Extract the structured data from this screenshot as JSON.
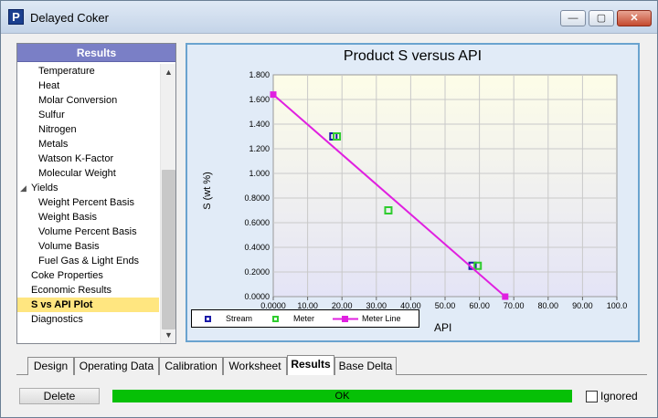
{
  "window": {
    "app_icon_letter": "P",
    "title": "Delayed Coker",
    "minimize_glyph": "—",
    "maximize_glyph": "▢",
    "close_glyph": "✕"
  },
  "nav": {
    "header": "Results",
    "items": [
      {
        "label": "Temperature"
      },
      {
        "label": "Heat"
      },
      {
        "label": "Molar Conversion"
      },
      {
        "label": "Sulfur"
      },
      {
        "label": "Nitrogen"
      },
      {
        "label": "Metals"
      },
      {
        "label": "Watson K-Factor"
      },
      {
        "label": "Molecular Weight"
      },
      {
        "label": "Yields",
        "expander": "◢"
      },
      {
        "label": "Weight Percent Basis"
      },
      {
        "label": "Weight Basis"
      },
      {
        "label": "Volume Percent Basis"
      },
      {
        "label": "Volume Basis"
      },
      {
        "label": "Fuel Gas & Light Ends"
      },
      {
        "label": "Coke Properties"
      },
      {
        "label": "Economic Results"
      },
      {
        "label": "S vs API Plot"
      },
      {
        "label": "Diagnostics"
      }
    ],
    "scroll_up": "▲",
    "scroll_down": "▼"
  },
  "chart_data": {
    "type": "scatter",
    "title": "Product S versus API",
    "xlabel": "API",
    "ylabel": "S (wt %)",
    "xlim": [
      0,
      100
    ],
    "ylim": [
      0,
      1.8
    ],
    "x_ticks": [
      "0.0000",
      "10.00",
      "20.00",
      "30.00",
      "40.00",
      "50.00",
      "60.00",
      "70.00",
      "80.00",
      "90.00",
      "100.0"
    ],
    "y_ticks": [
      "0.0000",
      "0.2000",
      "0.4000",
      "0.6000",
      "0.8000",
      "1.000",
      "1.200",
      "1.400",
      "1.600",
      "1.800"
    ],
    "grid": true,
    "legend_position": "bottom-left",
    "series": [
      {
        "name": "Stream",
        "kind": "points",
        "color": "#1a1aa8",
        "points": [
          [
            17.5,
            1.3
          ],
          [
            58.0,
            0.25
          ]
        ]
      },
      {
        "name": "Meter",
        "kind": "points",
        "color": "#2ecc2e",
        "points": [
          [
            18.5,
            1.3
          ],
          [
            33.5,
            0.7
          ],
          [
            59.5,
            0.25
          ]
        ]
      },
      {
        "name": "Meter Line",
        "kind": "line",
        "color": "#e020e0",
        "points": [
          [
            0.0,
            1.64
          ],
          [
            67.5,
            0.0
          ]
        ]
      }
    ]
  },
  "tabs": [
    "Design",
    "Operating Data",
    "Calibration",
    "Worksheet",
    "Results",
    "Base Delta"
  ],
  "active_tab": "Results",
  "footer": {
    "delete_label": "Delete",
    "status": "OK",
    "status_color": "#06c006",
    "ignored_label": "Ignored",
    "ignored_checked": false
  }
}
